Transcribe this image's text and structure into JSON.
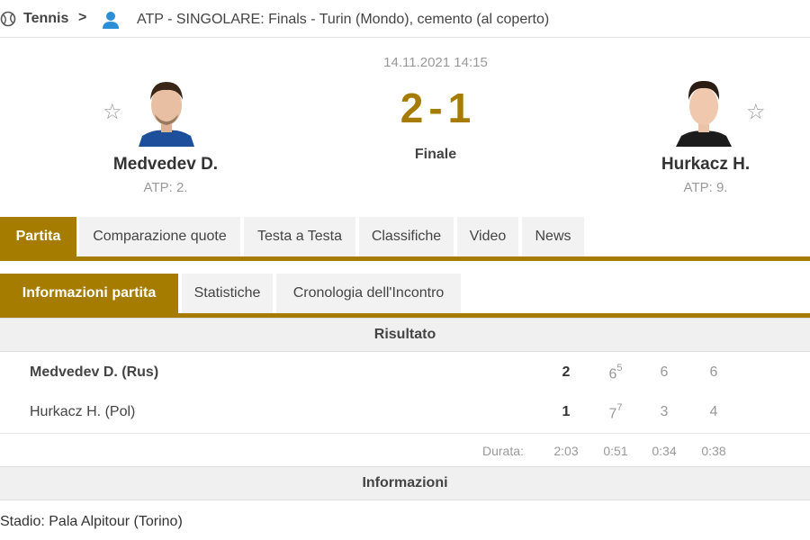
{
  "breadcrumb": {
    "sport_icon": "tennis-ball-icon",
    "sport": "Tennis",
    "chevron": ">",
    "user_icon": "player-icon",
    "tournament": "ATP - SINGOLARE: Finals - Turin (Mondo), cemento (al coperto)"
  },
  "match": {
    "date": "14.11.2021 14:15",
    "score_home": "2",
    "score_sep": "-",
    "score_away": "1",
    "status": "Finale",
    "home": {
      "name": "Medvedev D.",
      "rank": "ATP: 2.",
      "star_icon": "star-icon",
      "photo": "player-photo"
    },
    "away": {
      "name": "Hurkacz H.",
      "rank": "ATP: 9.",
      "star_icon": "star-icon",
      "photo": "player-photo"
    }
  },
  "tabs_main": [
    {
      "label": "Partita",
      "active": true
    },
    {
      "label": "Comparazione quote",
      "active": false
    },
    {
      "label": "Testa a Testa",
      "active": false
    },
    {
      "label": "Classifiche",
      "active": false
    },
    {
      "label": "Video",
      "active": false
    },
    {
      "label": "News",
      "active": false
    }
  ],
  "tabs_sub": [
    {
      "label": "Informazioni partita",
      "active": true
    },
    {
      "label": "Statistiche",
      "active": false
    },
    {
      "label": "Cronologia dell'Incontro",
      "active": false
    }
  ],
  "result": {
    "title": "Risultato",
    "home": {
      "name": "Medvedev D. (Rus)",
      "sets": "2",
      "s1": "6",
      "s1_tb": "5",
      "s2": "6",
      "s3": "6"
    },
    "away": {
      "name": "Hurkacz H. (Pol)",
      "sets": "1",
      "s1": "7",
      "s1_tb": "7",
      "s2": "3",
      "s3": "4"
    },
    "duration_label": "Durata:",
    "durations": [
      "2:03",
      "0:51",
      "0:34",
      "0:38"
    ]
  },
  "info": {
    "title": "Informazioni",
    "venue": "Stadio: Pala Alpitour (Torino)"
  },
  "colors": {
    "accent": "#a57c00",
    "muted": "#999999",
    "tab_bg": "#f2f2f2",
    "user_icon": "#2d8ed8"
  }
}
